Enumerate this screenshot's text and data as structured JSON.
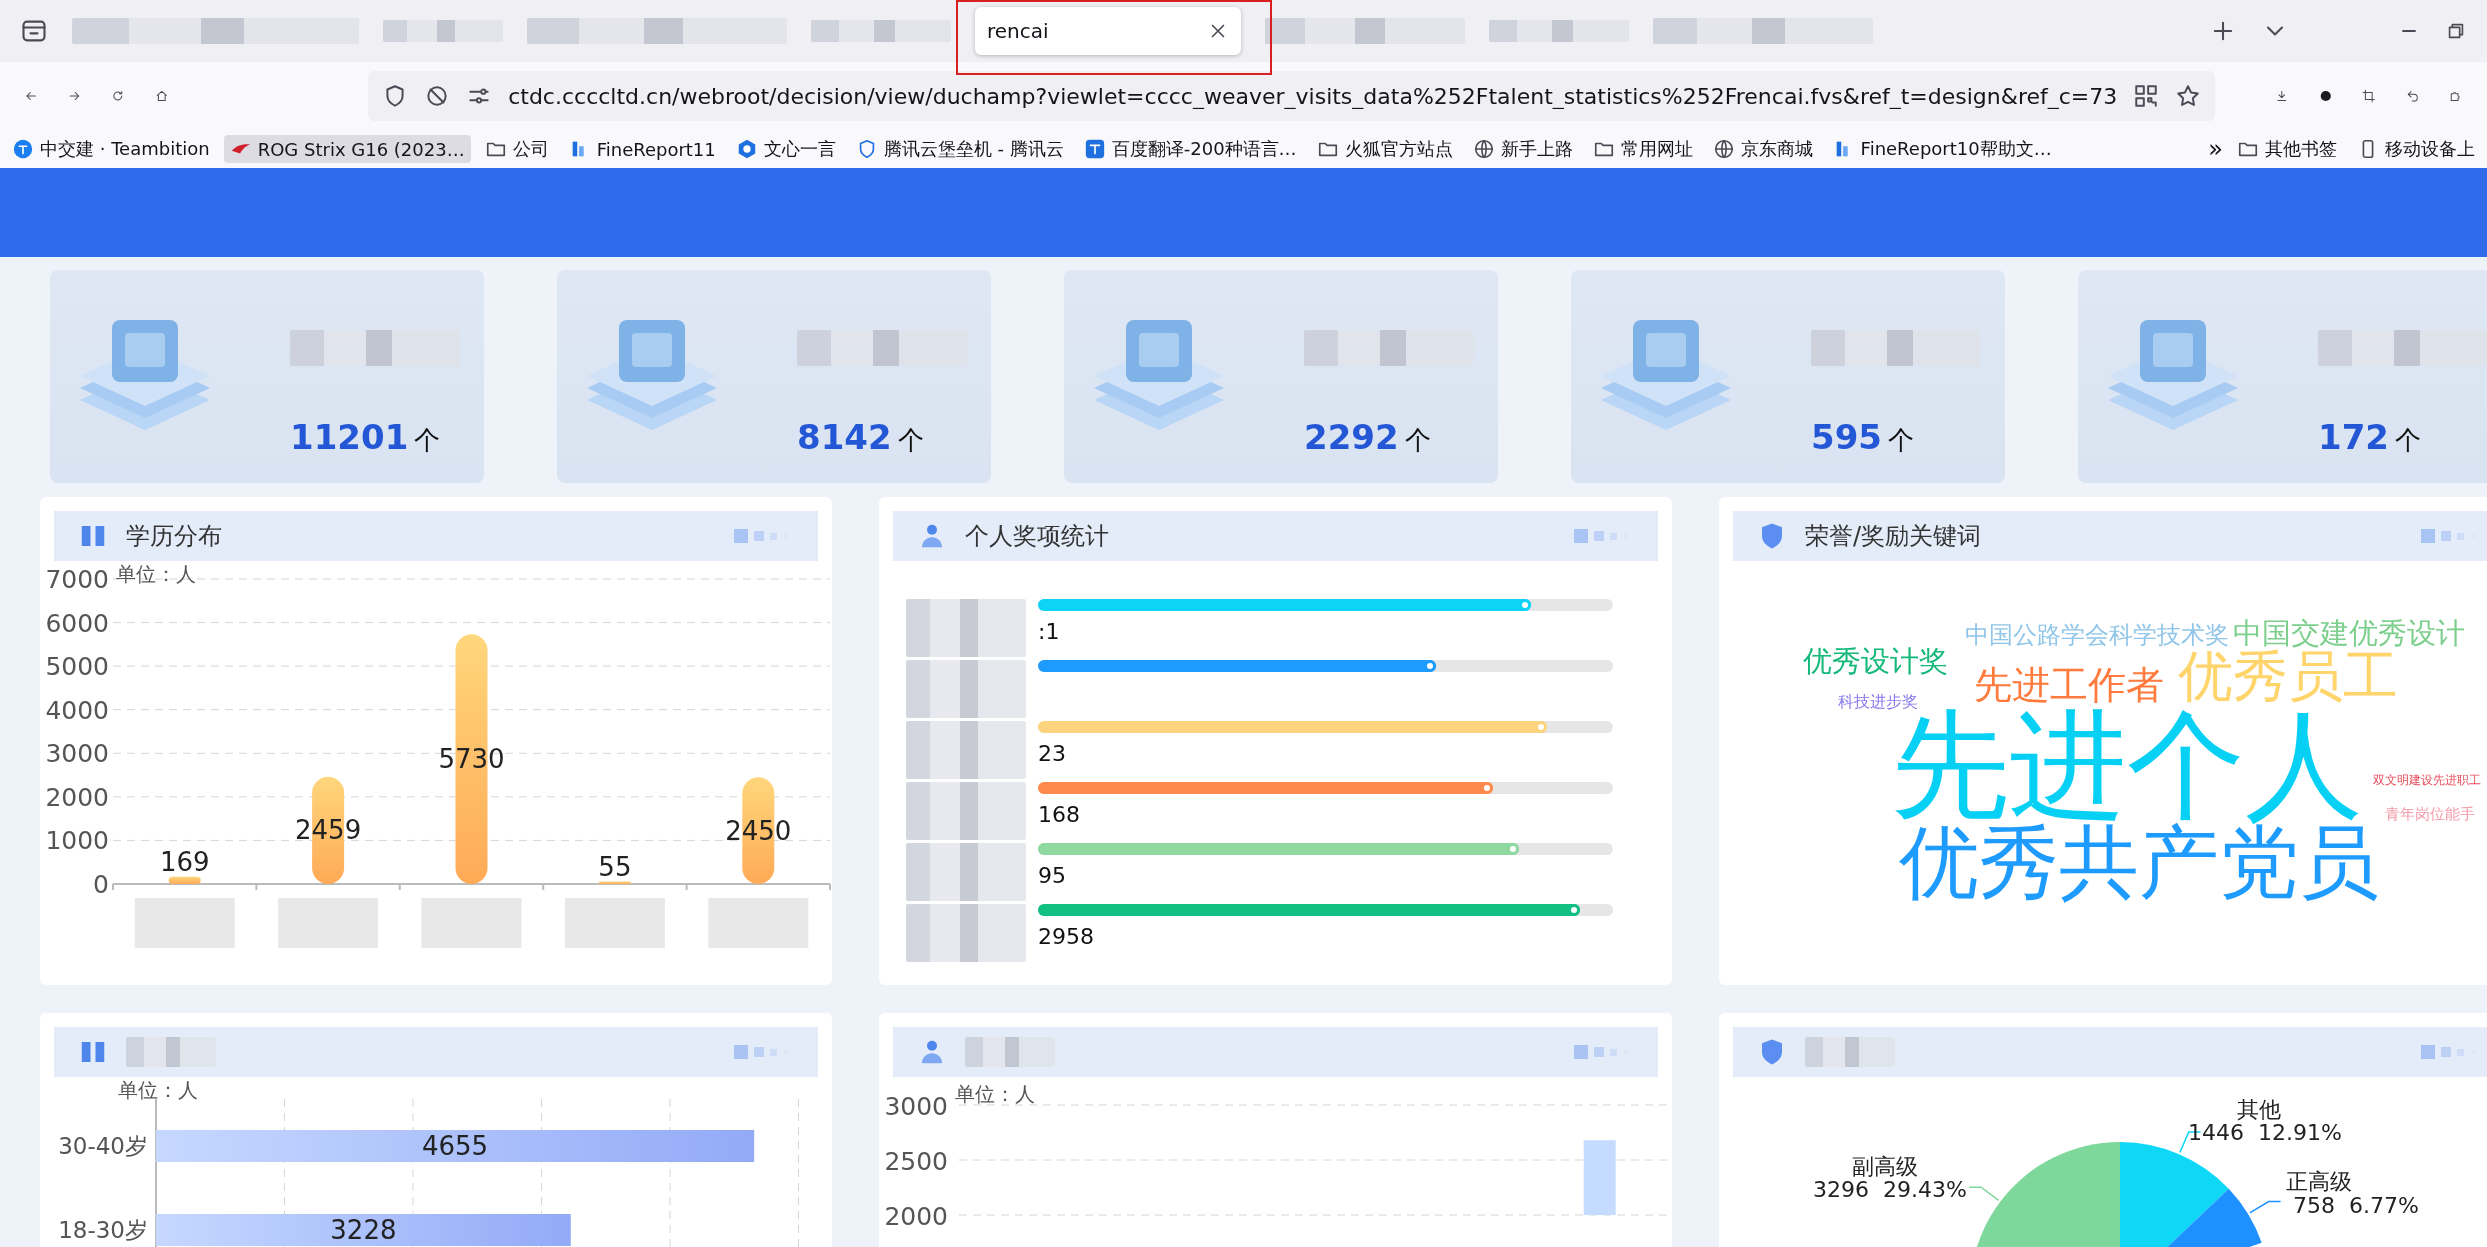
{
  "browser": {
    "tabs": [
      {
        "title": "rencai",
        "selected": true
      }
    ],
    "url": "ctdc.ccccltd.cn/webroot/decision/view/duchamp?viewlet=cccc_weaver_visits_data%252Ftalent_statistics%252Frencai.fvs&ref_t=design&ref_c=73",
    "bookmarks": [
      {
        "label": "中交建 · Teambition",
        "kind": "teambition",
        "highlighted": false
      },
      {
        "label": "ROG Strix G16 (2023…",
        "kind": "rog",
        "highlighted": true
      },
      {
        "label": "公司",
        "kind": "folder",
        "highlighted": false
      },
      {
        "label": "FineReport11",
        "kind": "finereport",
        "highlighted": false
      },
      {
        "label": "文心一言",
        "kind": "wenxin",
        "highlighted": false
      },
      {
        "label": "腾讯云堡垒机 - 腾讯云",
        "kind": "shield",
        "highlighted": false
      },
      {
        "label": "百度翻译-200种语言…",
        "kind": "translate",
        "highlighted": false
      },
      {
        "label": "火狐官方站点",
        "kind": "folder",
        "highlighted": false
      },
      {
        "label": "新手上路",
        "kind": "globe",
        "highlighted": false
      },
      {
        "label": "常用网址",
        "kind": "folder",
        "highlighted": false
      },
      {
        "label": "京东商城",
        "kind": "globe",
        "highlighted": false
      },
      {
        "label": "FineReport10帮助文…",
        "kind": "finereport",
        "highlighted": false
      }
    ],
    "bookmarks_overflow": "»",
    "other_bookmarks": [
      {
        "label": "其他书签",
        "kind": "folder"
      },
      {
        "label": "移动设备上",
        "kind": "device"
      }
    ]
  },
  "stats": [
    {
      "value": "11201",
      "unit": "个"
    },
    {
      "value": "8142",
      "unit": "个"
    },
    {
      "value": "2292",
      "unit": "个"
    },
    {
      "value": "595",
      "unit": "个"
    },
    {
      "value": "172",
      "unit": "个"
    }
  ],
  "education": {
    "title": "学历分布",
    "unit_label": "单位：人",
    "chart_data": {
      "type": "bar",
      "grid": true,
      "values": [
        169,
        2459,
        5730,
        55,
        2450
      ],
      "ylim": [
        0,
        7000
      ],
      "yticks": [
        0,
        1000,
        2000,
        3000,
        4000,
        5000,
        6000,
        7000
      ],
      "data_labels": true
    }
  },
  "awards": {
    "title": "个人奖项统计",
    "rows": [
      {
        "level": 0.858,
        "color": "#0dd3f7",
        "value_label": ":1"
      },
      {
        "level": 0.693,
        "color": "#1e9bff"
      },
      {
        "level": 0.885,
        "color": "#fdd47d",
        "value_label": "23"
      },
      {
        "level": 0.792,
        "color": "#ff8a4c",
        "value_label": "168"
      },
      {
        "level": 0.837,
        "color": "#8fd8a0",
        "value_label": "95"
      },
      {
        "level": 0.943,
        "color": "#13c083",
        "value_label": "2958"
      }
    ]
  },
  "keywords": {
    "title": "荣誉/奖励关键词",
    "words": [
      {
        "text": "中国公路学会科学技术奖",
        "color": "#8fc5e8"
      },
      {
        "text": "中国交建优秀设计",
        "color": "#7ccf8c"
      },
      {
        "text": "优秀设计奖",
        "color": "#13b87a"
      },
      {
        "text": "科技进步奖",
        "color": "#8878f0"
      },
      {
        "text": "先进工作者",
        "color": "#ff7a3c"
      },
      {
        "text": "优秀员工",
        "color": "#ffd46b"
      },
      {
        "text": "先进个人",
        "color": "#07d0f5"
      },
      {
        "text": "双文明建设先进职工",
        "color": "#e74c5a"
      },
      {
        "text": "青年岗位能手",
        "color": "#f59aa8"
      },
      {
        "text": "优秀共产党员",
        "color": "#1e9bff"
      }
    ]
  },
  "age": {
    "unit_label": "单位：人",
    "chart_data": {
      "type": "bar",
      "grid": true,
      "orientation": "horizontal",
      "categories": [
        "30-40岁",
        "18-30岁"
      ],
      "values": [
        4655,
        3228
      ],
      "data_labels": true
    }
  },
  "headcount": {
    "unit_label": "单位：人",
    "chart_data": {
      "type": "bar",
      "grid": true,
      "values": [
        null,
        null,
        null,
        null,
        null,
        null,
        2680
      ],
      "ylim": [
        2000,
        3000
      ],
      "yticks": [
        2000,
        2500,
        3000
      ]
    }
  },
  "titles": {
    "chart_data": {
      "type": "pie",
      "categories": [
        "其他",
        "正高级",
        "副高级"
      ],
      "values": [
        1446,
        758,
        3296
      ],
      "value_labels": [
        "1446  12.91%",
        "758  6.77%",
        "3296  29.43%"
      ]
    }
  }
}
